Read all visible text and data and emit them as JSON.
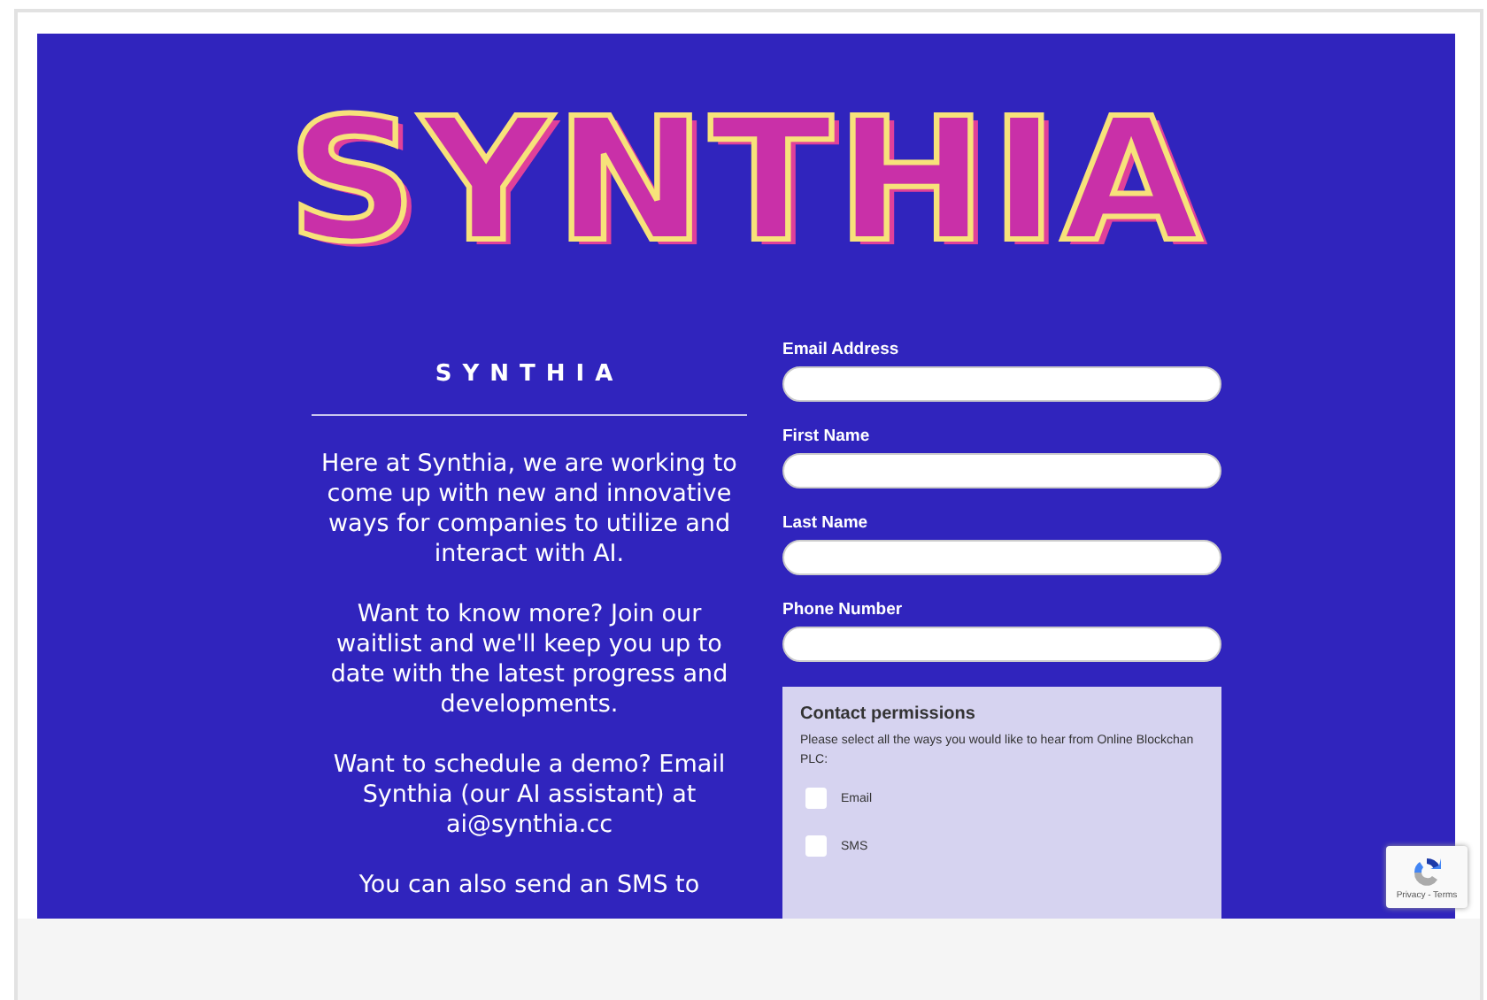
{
  "logo": {
    "text": "SYNTHIA"
  },
  "intro": {
    "heading": "SYNTHIA",
    "paragraphs": [
      "Here at Synthia, we are working to come up with new and innovative ways for companies to utilize and interact with AI.",
      "Want to know more? Join our waitlist and we'll keep you up to date with the latest progress and developments.",
      "Want to schedule a demo? Email Synthia (our AI assistant) at ai@synthia.cc",
      "You can also send an SMS to"
    ]
  },
  "form": {
    "fields": [
      {
        "label": "Email Address"
      },
      {
        "label": "First Name"
      },
      {
        "label": "Last Name"
      },
      {
        "label": "Phone Number"
      }
    ],
    "permissions": {
      "title": "Contact permissions",
      "description": "Please select all the ways you would like to hear from Online Blockchan PLC:",
      "options": [
        {
          "label": "Email",
          "checked": false
        },
        {
          "label": "SMS",
          "checked": false
        }
      ]
    }
  },
  "recaptcha": {
    "links": "Privacy - Terms"
  }
}
